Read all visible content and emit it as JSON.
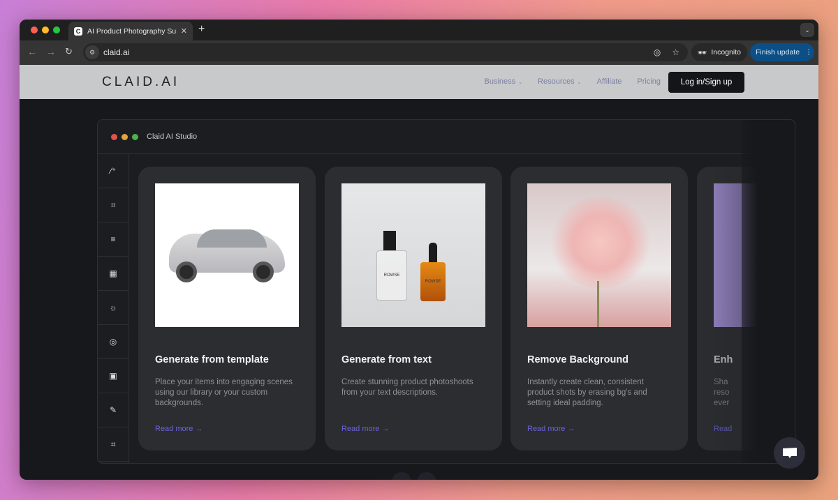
{
  "browser": {
    "tab_title": "AI Product Photography Suite",
    "favicon": "C",
    "url": "claid.ai",
    "incognito_label": "Incognito",
    "update_label": "Finish update"
  },
  "site": {
    "logo": "CLAID.AI",
    "nav": [
      {
        "label": "Business"
      },
      {
        "label": "Resources"
      },
      {
        "label": "Affiliate"
      },
      {
        "label": "Pricing"
      }
    ],
    "login_label": "Log in/Sign up"
  },
  "studio": {
    "title": "Claid AI Studio",
    "tools": [
      "magic-wand-icon",
      "crop-icon",
      "sliders-icon",
      "transparency-icon",
      "brightness-icon",
      "blend-icon",
      "image-add-icon",
      "pen-sparkle-icon",
      "crop-sparkle-icon"
    ],
    "cards": [
      {
        "title": "Generate from template",
        "description": "Place your items into engaging scenes using our library or your custom backgrounds.",
        "link": "Read more →"
      },
      {
        "title": "Generate from text",
        "description": "Create stunning product photoshoots from your text descriptions.",
        "link": "Read more →",
        "bottle_label": "ROWSE"
      },
      {
        "title": "Remove Background",
        "description": "Instantly create clean, consistent product shots by erasing bg's and setting ideal padding.",
        "link": "Read more →"
      },
      {
        "title": "Enh",
        "description": "Sha reso ever",
        "link": "Read"
      }
    ]
  },
  "colors": {
    "accent": "#6d63d9",
    "update_button": "#0b4f86"
  }
}
